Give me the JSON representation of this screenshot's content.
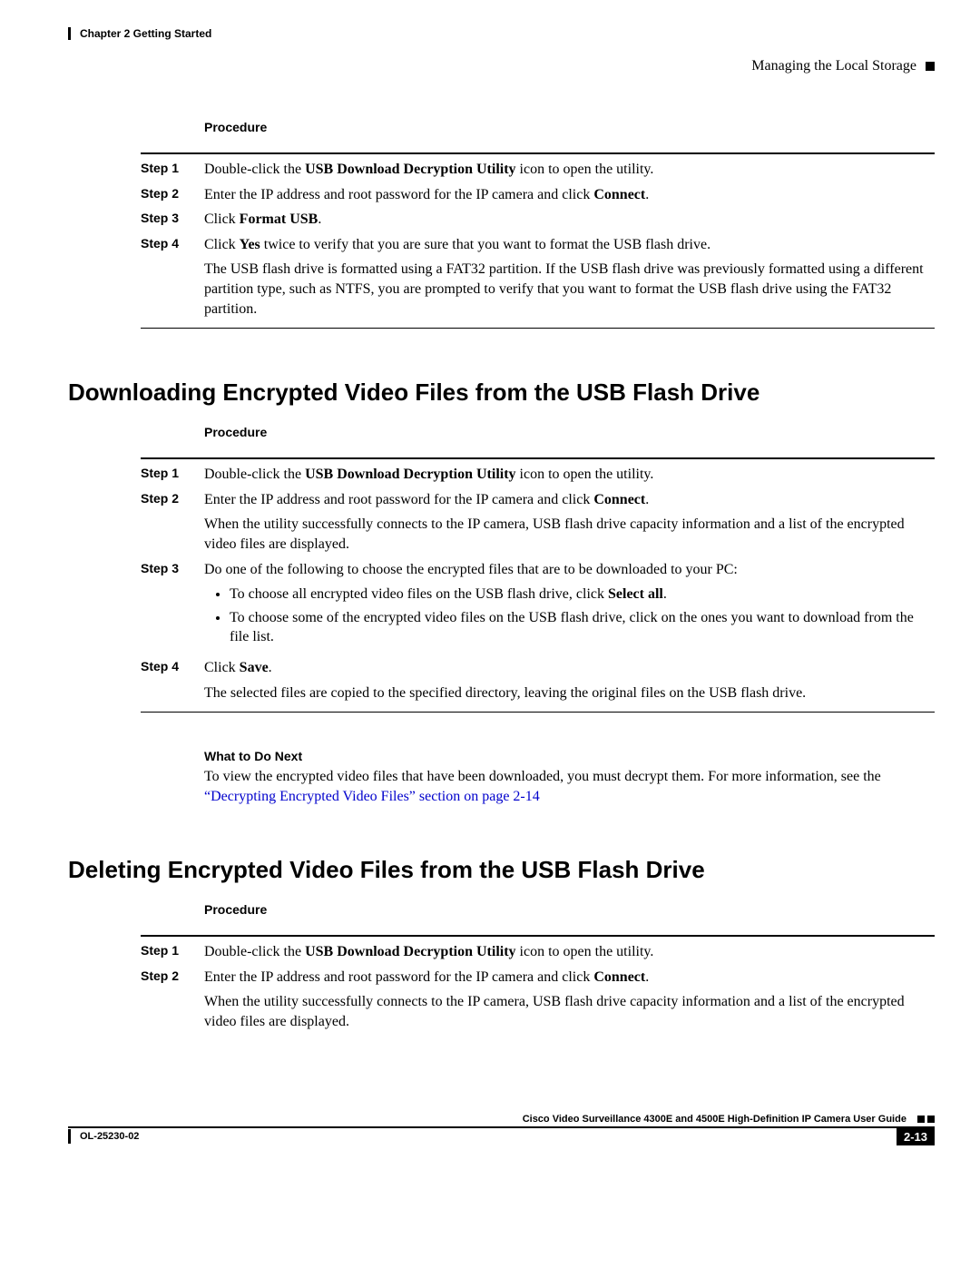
{
  "header": {
    "chapter": "Chapter 2      Getting Started",
    "section": "Managing the Local Storage"
  },
  "proc1": {
    "label": "Procedure",
    "steps": {
      "s1": {
        "label": "Step 1",
        "t1": "Double-click the ",
        "b1": "USB Download Decryption Utility",
        "t2": " icon to open the utility."
      },
      "s2": {
        "label": "Step 2",
        "t1": "Enter the IP address and root password for the IP camera and click ",
        "b1": "Connect",
        "t2": "."
      },
      "s3": {
        "label": "Step 3",
        "t1": "Click ",
        "b1": "Format USB",
        "t2": "."
      },
      "s4": {
        "label": "Step 4",
        "t1": "Click ",
        "b1": "Yes",
        "t2": " twice to verify that you are sure that you want to format the USB flash drive.",
        "note": "The USB flash drive is formatted using a FAT32 partition. If the USB flash drive was previously formatted using a different partition type, such as NTFS, you are prompted to verify that you want to format the USB flash drive using the FAT32 partition."
      }
    }
  },
  "section2": {
    "title": "Downloading Encrypted Video Files from the USB Flash Drive",
    "procLabel": "Procedure",
    "steps": {
      "s1": {
        "label": "Step 1",
        "t1": "Double-click the ",
        "b1": "USB Download Decryption Utility",
        "t2": " icon to open the utility."
      },
      "s2": {
        "label": "Step 2",
        "t1": "Enter the IP address and root password for the IP camera and click ",
        "b1": "Connect",
        "t2": ".",
        "note": "When the utility successfully connects to the IP camera, USB flash drive capacity information and a list of the encrypted video files are displayed."
      },
      "s3": {
        "label": "Step 3",
        "t1": "Do one of the following to choose the encrypted files that are to be downloaded to your PC:",
        "bul1a": "To choose all encrypted video files on the USB flash drive, click ",
        "bul1b": "Select all",
        "bul1c": ".",
        "bul2": "To choose some of the encrypted video files on the USB flash drive, click on the ones you want to download from the file list."
      },
      "s4": {
        "label": "Step 4",
        "t1": "Click ",
        "b1": "Save",
        "t2": ".",
        "note": "The selected files are copied to the specified directory, leaving the original files on the USB flash drive."
      }
    },
    "next": {
      "label": "What to Do Next",
      "t1": "To view the encrypted video files that have been downloaded, you must decrypt them. For more information, see the ",
      "link": "“Decrypting Encrypted Video Files” section on page 2-14"
    }
  },
  "section3": {
    "title": "Deleting Encrypted Video Files from the USB Flash Drive",
    "procLabel": "Procedure",
    "steps": {
      "s1": {
        "label": "Step 1",
        "t1": "Double-click the ",
        "b1": "USB Download Decryption Utility",
        "t2": " icon to open the utility."
      },
      "s2": {
        "label": "Step 2",
        "t1": "Enter the IP address and root password for the IP camera and click ",
        "b1": "Connect",
        "t2": ".",
        "note": "When the utility successfully connects to the IP camera, USB flash drive capacity information and a list of the encrypted video files are displayed."
      }
    }
  },
  "footer": {
    "title": "Cisco Video Surveillance 4300E and 4500E High-Definition IP Camera User Guide",
    "docid": "OL-25230-02",
    "pagenum": "2-13"
  }
}
